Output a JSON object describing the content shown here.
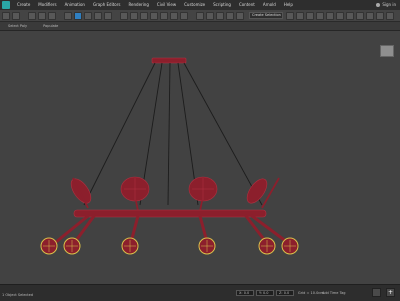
{
  "menu": {
    "items": [
      "Create",
      "Modifiers",
      "Animation",
      "Graph Editors",
      "Rendering",
      "Civil View",
      "Customize",
      "Scripting",
      "Content",
      "Arnold",
      "Help"
    ],
    "signin": "Sign in"
  },
  "toolbar": {
    "selection_set": "Create Selection Se"
  },
  "ribbon": {
    "tabs": [
      "Select Poly",
      "Populate"
    ]
  },
  "viewport": {
    "label": ""
  },
  "status": {
    "message": "1 Object Selected",
    "x_value": "X: 0.0",
    "y_value": "Y: 0.0",
    "z_value": "Z: 0.0",
    "grid_label": "Grid = 10.0cm",
    "add_time_tag": "Add Time Tag"
  },
  "colors": {
    "model": "#8c1f2c",
    "model_edge": "#b03040",
    "selection": "#d8c14a"
  }
}
